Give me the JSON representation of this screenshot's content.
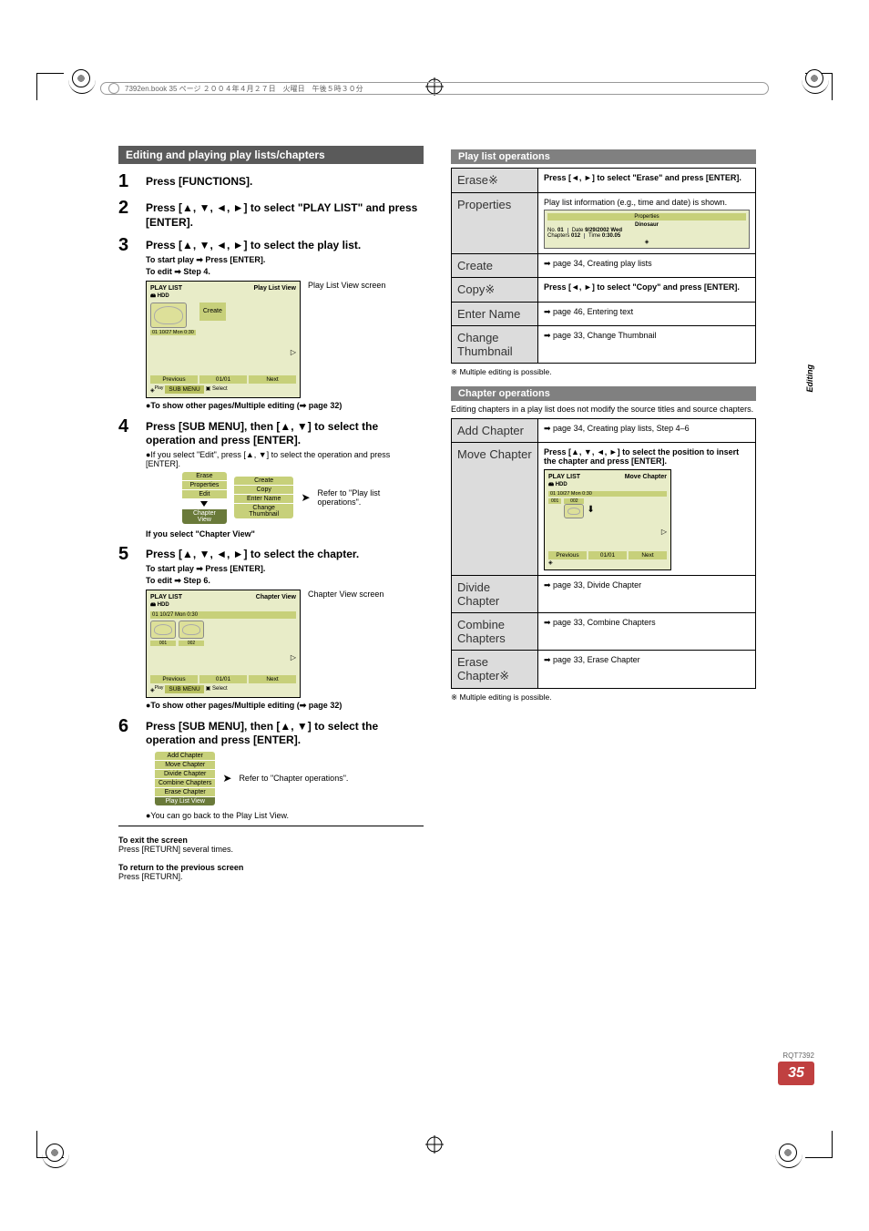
{
  "header_text": "7392en.book  35 ページ  ２００４年４月２７日　火曜日　午後５時３０分",
  "side_tab": "Editing",
  "page_rqt": "RQT7392",
  "page_num": "35",
  "left": {
    "section_title": "Editing and playing play lists/chapters",
    "steps": {
      "s1": {
        "num": "1",
        "title": "Press [FUNCTIONS]."
      },
      "s2": {
        "num": "2",
        "title": "Press [▲, ▼, ◄, ►] to select \"PLAY LIST\" and press [ENTER]."
      },
      "s3": {
        "num": "3",
        "title": "Press [▲, ▼, ◄, ►] to select the play list.",
        "sub1": "To start play ➡ Press [ENTER].",
        "sub2": "To edit ➡ Step 4.",
        "screen_label": "Play List View screen",
        "bullet": "●To show other pages/Multiple editing (➡ page 32)",
        "screen": {
          "title_left": "PLAY LIST",
          "hdd": "🖴 HDD",
          "title_right": "Play List View",
          "item_caption": "01 10/27 Mon 0:30",
          "create": "Create",
          "prev": "Previous",
          "page": "01/01",
          "next": "Next",
          "play": "Play",
          "submenu": "SUB MENU",
          "select": "Select"
        }
      },
      "s4": {
        "num": "4",
        "title": "Press [SUB MENU], then [▲, ▼] to select the operation and press [ENTER].",
        "note": "●If you select \"Edit\", press [▲, ▼] to select the operation and press [ENTER].",
        "ref": "Refer to \"Play list operations\".",
        "if_chapter": "If you select \"Chapter View\"",
        "menu_left": {
          "erase": "Erase",
          "properties": "Properties",
          "edit": "Edit",
          "chapter_view": "Chapter View"
        },
        "menu_right": {
          "create": "Create",
          "copy": "Copy",
          "enter_name": "Enter Name",
          "change_thumb": "Change Thumbnail"
        }
      },
      "s5": {
        "num": "5",
        "title": "Press [▲, ▼, ◄, ►] to select the chapter.",
        "sub1": "To start play ➡ Press [ENTER].",
        "sub2": "To edit ➡ Step 6.",
        "screen_label": "Chapter View screen",
        "bullet": "●To show other pages/Multiple editing (➡ page 32)",
        "screen": {
          "title_left": "PLAY LIST",
          "hdd": "🖴 HDD",
          "title_right": "Chapter View",
          "item_caption": "01 10/27 Mon 0:30",
          "c001": "001",
          "c002": "002",
          "prev": "Previous",
          "page": "01/01",
          "next": "Next",
          "play": "Play",
          "submenu": "SUB MENU",
          "select": "Select"
        }
      },
      "s6": {
        "num": "6",
        "title": "Press [SUB MENU], then [▲, ▼] to select the operation and press [ENTER].",
        "ref": "Refer to \"Chapter operations\".",
        "note": "●You can go back to the Play List View.",
        "menu": {
          "add": "Add Chapter",
          "move": "Move Chapter",
          "divide": "Divide Chapter",
          "combine": "Combine Chapters",
          "erase": "Erase Chapter",
          "plv": "Play List View"
        }
      }
    },
    "exit1_b": "To exit the screen",
    "exit1": "Press [RETURN] several times.",
    "exit2_b": "To return to the previous screen",
    "exit2": "Press [RETURN]."
  },
  "right": {
    "pl_ops_title": "Play list operations",
    "pl_ops": {
      "erase": {
        "name": "Erase※",
        "desc": "Press [◄, ►] to select \"Erase\" and press [ENTER]."
      },
      "properties": {
        "name": "Properties",
        "desc": "Play list information (e.g., time and date) is shown.",
        "mini": {
          "title": "Properties",
          "name": "Dinosaur",
          "no_lbl": "No.",
          "no_val": "01",
          "date_lbl": "Date",
          "date_val": "9/29/2002 Wed",
          "ch_lbl": "Chapters",
          "ch_val": "012",
          "time_lbl": "Time",
          "time_val": "0:30.05"
        }
      },
      "create": {
        "name": "Create",
        "desc": "➡ page 34, Creating play lists"
      },
      "copy": {
        "name": "Copy※",
        "desc": "Press [◄, ►] to select \"Copy\" and press [ENTER]."
      },
      "enter_name": {
        "name": "Enter Name",
        "desc": "➡ page 46, Entering text"
      },
      "change_thumb": {
        "name": "Change Thumbnail",
        "desc": "➡ page 33, Change Thumbnail"
      }
    },
    "pl_foot": "※ Multiple editing is possible.",
    "ch_ops_title": "Chapter operations",
    "ch_intro": "Editing chapters in a play list does not modify the source titles and source chapters.",
    "ch_ops": {
      "add": {
        "name": "Add Chapter",
        "desc": "➡ page 34, Creating play lists, Step 4–6"
      },
      "move": {
        "name": "Move Chapter",
        "desc": "Press [▲, ▼, ◄, ►] to select the position to insert the chapter and press [ENTER].",
        "screen": {
          "title_left": "PLAY LIST",
          "hdd": "🖴 HDD",
          "title_right": "Move Chapter",
          "item_caption": "01 10/27 Mon 0:30",
          "c001": "001",
          "c002": "002",
          "prev": "Previous",
          "page": "01/01",
          "next": "Next"
        }
      },
      "divide": {
        "name": "Divide Chapter",
        "desc": "➡ page 33, Divide Chapter"
      },
      "combine": {
        "name": "Combine Chapters",
        "desc": "➡ page 33, Combine Chapters"
      },
      "erase": {
        "name": "Erase Chapter※",
        "desc": "➡ page 33, Erase Chapter"
      }
    },
    "ch_foot": "※ Multiple editing is possible."
  }
}
